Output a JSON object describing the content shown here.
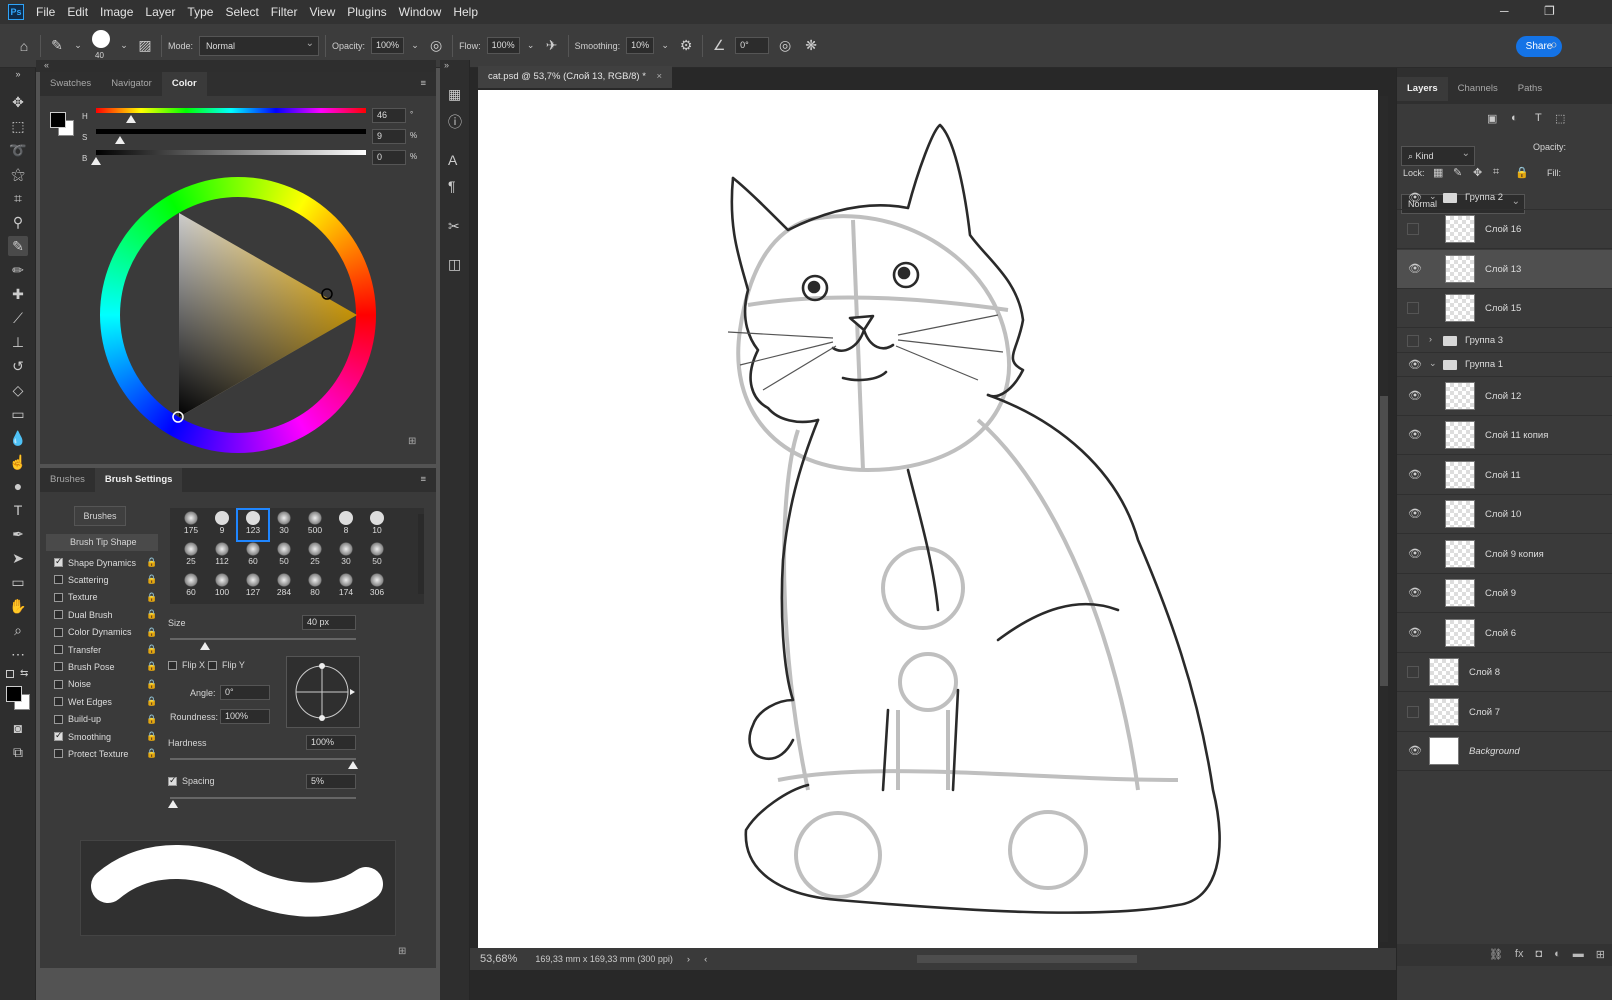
{
  "menu": {
    "logo": "Ps",
    "items": [
      "File",
      "Edit",
      "Image",
      "Layer",
      "Type",
      "Select",
      "Filter",
      "View",
      "Plugins",
      "Window",
      "Help"
    ],
    "minimize": "─",
    "restore": "❐"
  },
  "options": {
    "brush_size": "40",
    "mode_label": "Mode:",
    "mode_value": "Normal",
    "opacity_label": "Opacity:",
    "opacity_value": "100%",
    "flow_label": "Flow:",
    "flow_value": "100%",
    "smoothing_label": "Smoothing:",
    "smoothing_value": "10%",
    "angle_value": "0°",
    "share": "Share"
  },
  "color_panel": {
    "tabs": [
      "Swatches",
      "Navigator",
      "Color"
    ],
    "h_label": "H",
    "s_label": "S",
    "b_label": "B",
    "h_value": "46",
    "s_value": "9",
    "b_value": "0",
    "h_unit": "°",
    "s_unit": "%",
    "b_unit": "%",
    "h_fraction": 0.128,
    "s_fraction": 0.09,
    "b_fraction": 0.0
  },
  "brush_panel": {
    "tabs": [
      "Brushes",
      "Brush Settings"
    ],
    "brushes_button": "Brushes",
    "tip_shape": "Brush Tip Shape",
    "options": [
      {
        "label": "Shape Dynamics",
        "checked": true
      },
      {
        "label": "Scattering",
        "checked": false
      },
      {
        "label": "Texture",
        "checked": false
      },
      {
        "label": "Dual Brush",
        "checked": false
      },
      {
        "label": "Color Dynamics",
        "checked": false
      },
      {
        "label": "Transfer",
        "checked": false
      },
      {
        "label": "Brush Pose",
        "checked": false
      },
      {
        "label": "Noise",
        "checked": false
      },
      {
        "label": "Wet Edges",
        "checked": false
      },
      {
        "label": "Build-up",
        "checked": false
      },
      {
        "label": "Smoothing",
        "checked": true
      },
      {
        "label": "Protect Texture",
        "checked": false
      }
    ],
    "tips": [
      "175",
      "9",
      "123",
      "30",
      "500",
      "8",
      "10",
      "25",
      "112",
      "60",
      "50",
      "25",
      "30",
      "50",
      "60",
      "100",
      "127",
      "284",
      "80",
      "174",
      "306"
    ],
    "size_label": "Size",
    "size_value": "40 px",
    "flip_x": "Flip X",
    "flip_y": "Flip Y",
    "angle_label": "Angle:",
    "angle_value": "0°",
    "roundness_label": "Roundness:",
    "roundness_value": "100%",
    "hardness_label": "Hardness",
    "hardness_value": "100%",
    "spacing_label": "Spacing",
    "spacing_value": "5%"
  },
  "document": {
    "tab": "cat.psd @ 53,7% (Слой 13, RGB/8) *",
    "close": "×",
    "zoom": "53,68%",
    "dimensions": "169,33 mm x 169,33 mm (300 ppi)"
  },
  "layers_panel": {
    "tabs": [
      "Layers",
      "Channels",
      "Paths"
    ],
    "kind": "Kind",
    "blend": "Normal",
    "opacity_label": "Opacity:",
    "lock_label": "Lock:",
    "fill_label": "Fill:",
    "rows": [
      {
        "name": "Группа 2",
        "type": "group",
        "visible": true
      },
      {
        "name": "Слой 16",
        "type": "layer",
        "visible": false
      },
      {
        "name": "Слой 13",
        "type": "layer",
        "visible": true,
        "selected": true
      },
      {
        "name": "Слой 15",
        "type": "layer",
        "visible": false
      },
      {
        "name": "Группа 3",
        "type": "group",
        "visible": false
      },
      {
        "name": "Группа 1",
        "type": "group",
        "visible": true
      },
      {
        "name": "Слой 12",
        "type": "layer",
        "visible": true
      },
      {
        "name": "Слой 11 копия",
        "type": "layer",
        "visible": true
      },
      {
        "name": "Слой 11",
        "type": "layer",
        "visible": true
      },
      {
        "name": "Слой 10",
        "type": "layer",
        "visible": true
      },
      {
        "name": "Слой 9 копия",
        "type": "layer",
        "visible": true
      },
      {
        "name": "Слой 9",
        "type": "layer",
        "visible": true
      },
      {
        "name": "Слой 6",
        "type": "layer",
        "visible": true
      },
      {
        "name": "Слой 8",
        "type": "layer",
        "visible": false
      },
      {
        "name": "Слой 7",
        "type": "layer",
        "visible": false
      },
      {
        "name": "Background",
        "type": "background",
        "visible": true
      }
    ]
  },
  "colors": {
    "accent": "#1473e6",
    "panel": "#3a3a3a",
    "dark": "#2e2e2e"
  }
}
